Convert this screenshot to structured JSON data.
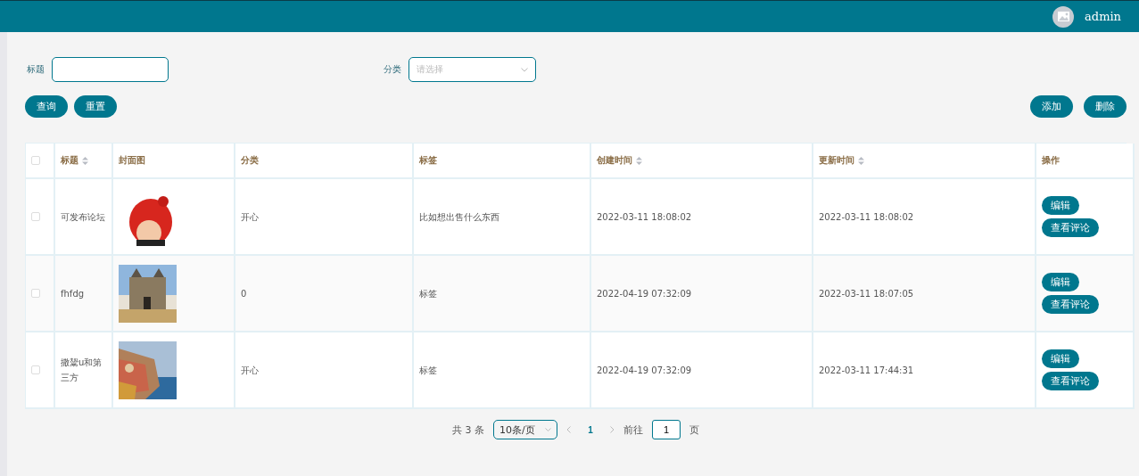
{
  "header": {
    "user": "admin"
  },
  "search": {
    "fields": [
      {
        "label": "标题",
        "kind": "input"
      },
      {
        "label": "分类",
        "kind": "select",
        "placeholder": "请选择"
      }
    ],
    "buttons": [
      "查询",
      "重置"
    ],
    "actions": [
      "添加",
      "删除"
    ]
  },
  "table": {
    "columns": [
      {
        "label": "标题",
        "sortable": true
      },
      {
        "label": "封面图",
        "sortable": false
      },
      {
        "label": "分类",
        "sortable": false
      },
      {
        "label": "标签",
        "sortable": false
      },
      {
        "label": "创建时间",
        "sortable": true
      },
      {
        "label": "更新时间",
        "sortable": true
      },
      {
        "label": "操作",
        "sortable": false
      }
    ],
    "header_checked": false,
    "rows": [
      {
        "checked": false,
        "title": "可发布论坛",
        "cover": {
          "kind": "picture"
        },
        "category": "开心",
        "tag": "比如想出售什么东西",
        "created": "2022-03-11 18:08:02",
        "updated": "2022-03-11 18:08:02",
        "actions": [
          "编辑",
          "查看评论"
        ]
      },
      {
        "checked": false,
        "title": "fhfdg",
        "cover": {
          "kind": "picture"
        },
        "category": "0",
        "tag": "标签",
        "created": "2022-04-19 07:32:09",
        "updated": "2022-03-11 18:07:05",
        "actions": [
          "编辑",
          "查看评论"
        ]
      },
      {
        "checked": false,
        "title": "撒鬶u和第三方",
        "cover": {
          "kind": "picture"
        },
        "category": "开心",
        "tag": "标签",
        "created": "2022-04-19 07:32:09",
        "updated": "2022-03-11 17:44:31",
        "actions": [
          "编辑",
          "查看评论"
        ]
      }
    ]
  },
  "pagination": {
    "total": "共 3 条",
    "page_size": "10条/页",
    "pages": [
      {
        "label": "1",
        "selected": true
      }
    ],
    "goto_label": "前往",
    "goto_value": "1",
    "goto_suffix": "页"
  }
}
